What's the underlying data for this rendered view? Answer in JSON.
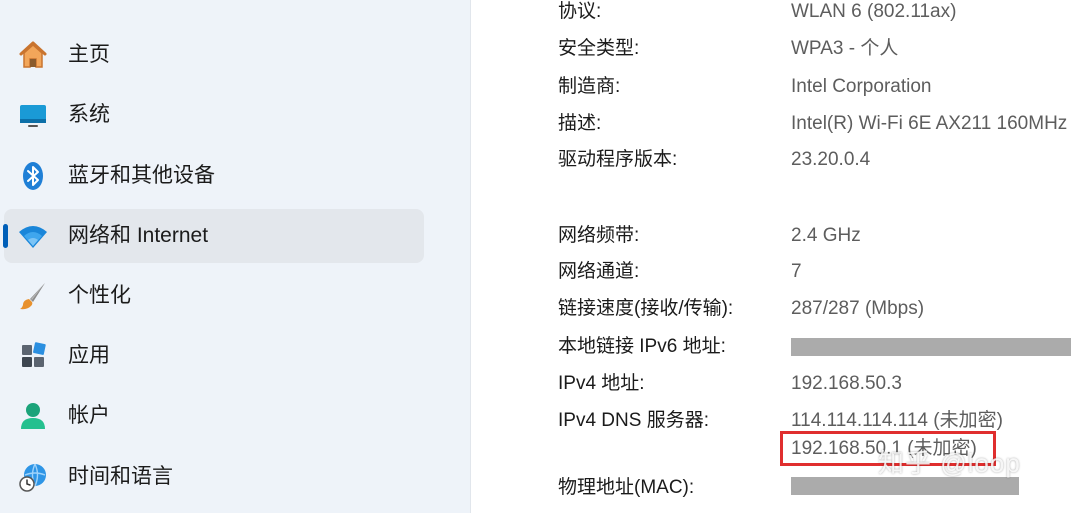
{
  "sidebar": {
    "items": [
      {
        "label": "主页",
        "icon": "home-icon"
      },
      {
        "label": "系统",
        "icon": "system-icon"
      },
      {
        "label": "蓝牙和其他设备",
        "icon": "bluetooth-icon"
      },
      {
        "label": "网络和 Internet",
        "icon": "wifi-icon",
        "active": true
      },
      {
        "label": "个性化",
        "icon": "brush-icon"
      },
      {
        "label": "应用",
        "icon": "apps-icon"
      },
      {
        "label": "帐户",
        "icon": "account-icon"
      },
      {
        "label": "时间和语言",
        "icon": "time-language-icon"
      }
    ]
  },
  "details": {
    "protocol": {
      "label": "协议:",
      "value": "WLAN 6 (802.11ax)"
    },
    "security": {
      "label": "安全类型:",
      "value": "WPA3 - 个人"
    },
    "manufacturer": {
      "label": "制造商:",
      "value": "Intel Corporation"
    },
    "description": {
      "label": "描述:",
      "value": "Intel(R) Wi-Fi 6E AX211 160MHz"
    },
    "driver": {
      "label": "驱动程序版本:",
      "value": "23.20.0.4"
    },
    "band": {
      "label": "网络频带:",
      "value": "2.4 GHz"
    },
    "channel": {
      "label": "网络通道:",
      "value": "7"
    },
    "link_speed": {
      "label": "链接速度(接收/传输):",
      "value": "287/287 (Mbps)"
    },
    "ipv6": {
      "label": "本地链接 IPv6 地址:"
    },
    "ipv4": {
      "label": "IPv4 地址:",
      "value": "192.168.50.3"
    },
    "dns": {
      "label": "IPv4 DNS 服务器:",
      "value1": "114.114.114.114 (未加密)",
      "value2": "192.168.50.1 (未加密)"
    },
    "mac": {
      "label": "物理地址(MAC):"
    }
  },
  "watermark": "知乎 @loop",
  "colors": {
    "sidebar_bg": "#eef3f9",
    "accent": "#005fb8",
    "highlight": "#e02e2e",
    "value_text": "#5d5d5d"
  }
}
